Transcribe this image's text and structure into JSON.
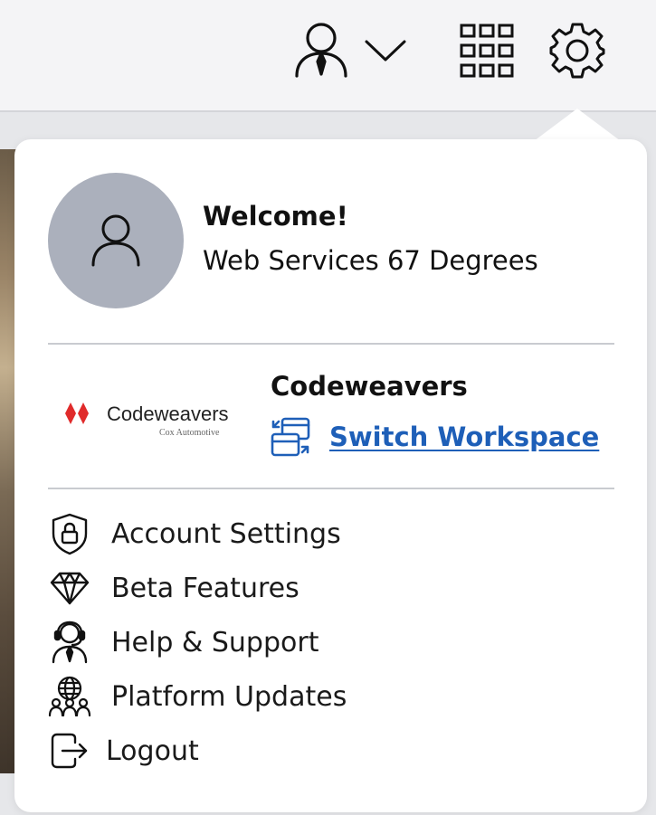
{
  "header": {
    "icons": [
      "user-icon",
      "chevron-down-icon",
      "apps-grid-icon",
      "gear-icon"
    ]
  },
  "profile": {
    "welcome": "Welcome!",
    "name": "Web Services 67 Degrees",
    "avatar_icon": "user-icon"
  },
  "organization": {
    "logo_text": "Codeweavers",
    "logo_subtext": "Cox Automotive",
    "name": "Codeweavers",
    "switch_label": "Switch Workspace"
  },
  "menu": {
    "items": [
      {
        "label": "Account Settings",
        "icon": "shield-lock-icon"
      },
      {
        "label": "Beta Features",
        "icon": "diamond-icon"
      },
      {
        "label": "Help & Support",
        "icon": "headset-icon"
      },
      {
        "label": "Platform Updates",
        "icon": "globe-people-icon"
      },
      {
        "label": "Logout",
        "icon": "logout-icon"
      }
    ]
  },
  "colors": {
    "link": "#1e5fb8",
    "avatar_bg": "#abb0bc",
    "brand_red": "#e02b2b"
  }
}
